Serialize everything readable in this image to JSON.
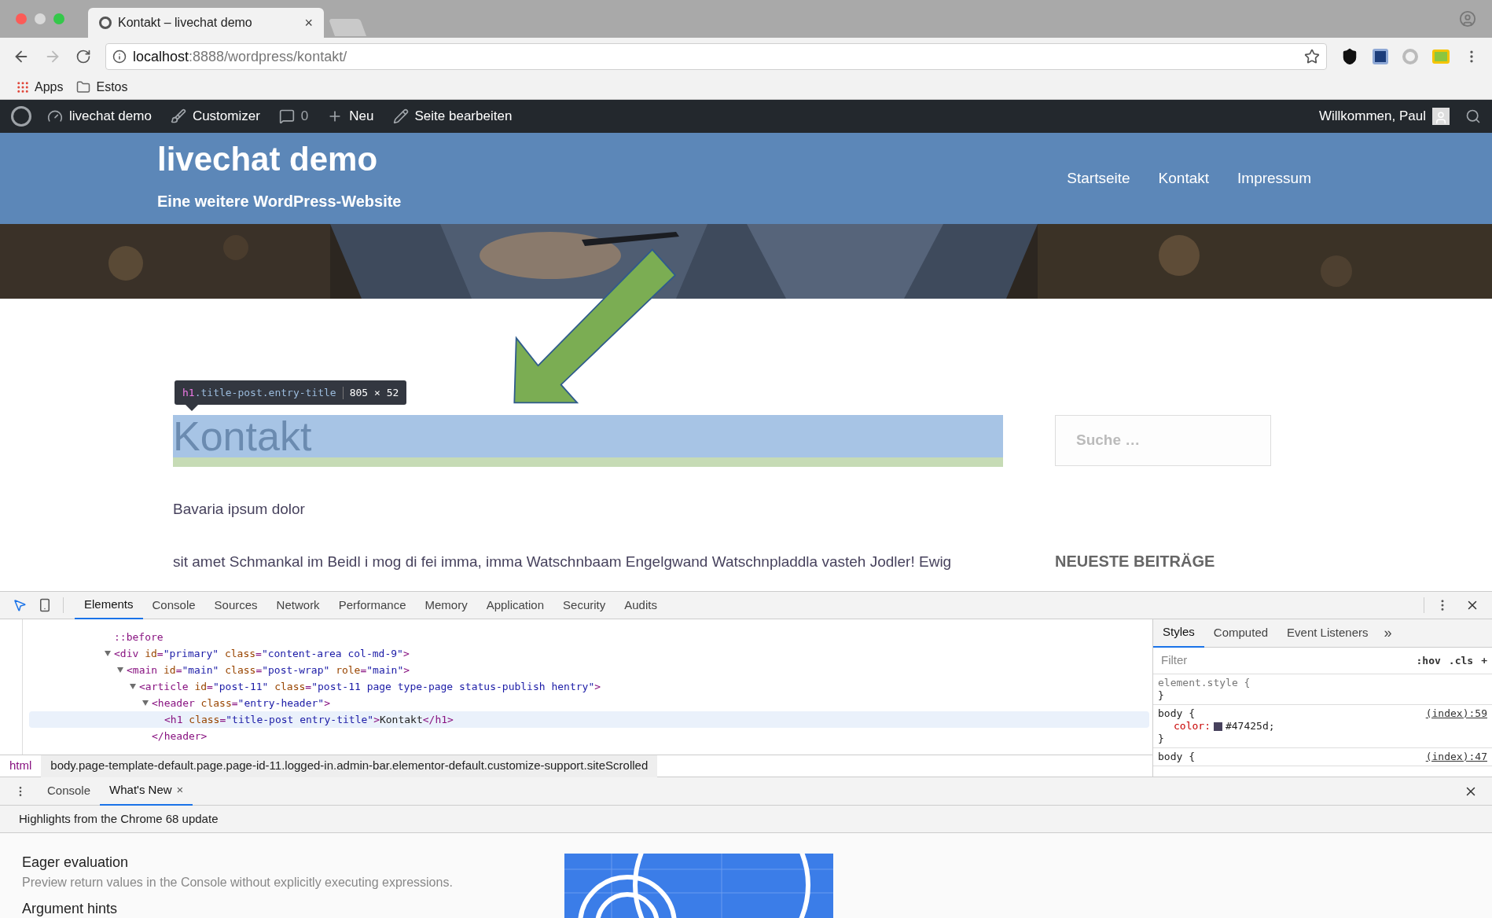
{
  "browser": {
    "tab_title": "Kontakt – livechat demo",
    "tab_close": "×",
    "url_host": "localhost",
    "url_path": ":8888/wordpress/kontakt/",
    "bookmarks": [
      {
        "kind": "apps",
        "label": "Apps"
      },
      {
        "kind": "folder",
        "label": "Estos"
      }
    ]
  },
  "admin_bar": {
    "items": [
      {
        "kind": "site",
        "label": "livechat demo"
      },
      {
        "kind": "customizer",
        "label": "Customizer"
      },
      {
        "kind": "comments",
        "label": "0"
      },
      {
        "kind": "new",
        "label": "Neu"
      },
      {
        "kind": "edit",
        "label": "Seite bearbeiten"
      }
    ],
    "greeting": "Willkommen, Paul"
  },
  "site": {
    "title": "livechat demo",
    "tagline": "Eine weitere WordPress-Website",
    "nav": [
      {
        "label": "Startseite"
      },
      {
        "label": "Kontakt"
      },
      {
        "label": "Impressum"
      }
    ]
  },
  "inspector_tooltip": {
    "tag": "h1",
    "classes": ".title-post.entry-title",
    "size": "805 × 52"
  },
  "page": {
    "heading": "Kontakt",
    "paragraphs": [
      "Bavaria ipsum dolor",
      "sit amet Schmankal im Beidl i mog di fei imma, imma Watschnbaam Engelgwand Watschnpladdla vasteh Jodler! Ewig"
    ],
    "search_placeholder": "Suche …",
    "sidebar_heading": "NEUESTE BEITRÄGE"
  },
  "devtools": {
    "tabs": [
      {
        "label": "Elements",
        "selected": true
      },
      {
        "label": "Console",
        "selected": false
      },
      {
        "label": "Sources",
        "selected": false
      },
      {
        "label": "Network",
        "selected": false
      },
      {
        "label": "Performance",
        "selected": false
      },
      {
        "label": "Memory",
        "selected": false
      },
      {
        "label": "Application",
        "selected": false
      },
      {
        "label": "Security",
        "selected": false
      },
      {
        "label": "Audits",
        "selected": false
      }
    ],
    "dom": [
      {
        "tokens": [
          {
            "kind": "pseudo",
            "s": "::before"
          }
        ],
        "selected": false
      },
      {
        "tokens": [
          {
            "kind": "tag",
            "s": "<div"
          },
          {
            "kind": "attr",
            "s": " id"
          },
          {
            "kind": "tag",
            "s": "="
          },
          {
            "kind": "value",
            "s": "\"primary\""
          },
          {
            "kind": "attr",
            "s": " class"
          },
          {
            "kind": "tag",
            "s": "="
          },
          {
            "kind": "value",
            "s": "\"content-area col-md-9\""
          },
          {
            "kind": "tag",
            "s": ">"
          }
        ],
        "expanded": true,
        "selected": false,
        "children": [
          {
            "tokens": [
              {
                "kind": "tag",
                "s": "<main"
              },
              {
                "kind": "attr",
                "s": " id"
              },
              {
                "kind": "tag",
                "s": "="
              },
              {
                "kind": "value",
                "s": "\"main\""
              },
              {
                "kind": "attr",
                "s": " class"
              },
              {
                "kind": "tag",
                "s": "="
              },
              {
                "kind": "value",
                "s": "\"post-wrap\""
              },
              {
                "kind": "attr",
                "s": " role"
              },
              {
                "kind": "tag",
                "s": "="
              },
              {
                "kind": "value",
                "s": "\"main\""
              },
              {
                "kind": "tag",
                "s": ">"
              }
            ],
            "expanded": true,
            "selected": false,
            "children": [
              {
                "tokens": [
                  {
                    "kind": "tag",
                    "s": "<article"
                  },
                  {
                    "kind": "attr",
                    "s": " id"
                  },
                  {
                    "kind": "tag",
                    "s": "="
                  },
                  {
                    "kind": "value",
                    "s": "\"post-11\""
                  },
                  {
                    "kind": "attr",
                    "s": " class"
                  },
                  {
                    "kind": "tag",
                    "s": "="
                  },
                  {
                    "kind": "value",
                    "s": "\"post-11 page type-page status-publish hentry\""
                  },
                  {
                    "kind": "tag",
                    "s": ">"
                  }
                ],
                "expanded": true,
                "selected": false,
                "children": [
                  {
                    "tokens": [
                      {
                        "kind": "tag",
                        "s": "<header"
                      },
                      {
                        "kind": "attr",
                        "s": " class"
                      },
                      {
                        "kind": "tag",
                        "s": "="
                      },
                      {
                        "kind": "value",
                        "s": "\"entry-header\""
                      },
                      {
                        "kind": "tag",
                        "s": ">"
                      }
                    ],
                    "expanded": true,
                    "selected": false,
                    "close": "</header>",
                    "children": [
                      {
                        "tokens": [
                          {
                            "kind": "tag",
                            "s": "<h1"
                          },
                          {
                            "kind": "attr",
                            "s": " class"
                          },
                          {
                            "kind": "tag",
                            "s": "="
                          },
                          {
                            "kind": "value",
                            "s": "\"title-post entry-title\""
                          },
                          {
                            "kind": "tag",
                            "s": ">"
                          },
                          {
                            "kind": "text",
                            "s": "Kontakt"
                          },
                          {
                            "kind": "tag",
                            "s": "</h1>"
                          }
                        ],
                        "selected": true
                      }
                    ]
                  }
                ]
              }
            ]
          }
        ]
      }
    ],
    "breadcrumbs": [
      {
        "label": "html",
        "selected": false
      },
      {
        "label": "body.page-template-default.page.page-id-11.logged-in.admin-bar.elementor-default.customize-support.siteScrolled",
        "selected": true
      }
    ],
    "side_tabs": [
      {
        "label": "Styles",
        "selected": true
      },
      {
        "label": "Computed",
        "selected": false
      },
      {
        "label": "Event Listeners",
        "selected": false
      }
    ],
    "side_more": "»",
    "filter_placeholder": "Filter",
    "filter_buttons": [
      ":hov",
      ".cls",
      "+"
    ],
    "rules": [
      {
        "open": "element.style {",
        "close": "}"
      },
      {
        "open": "body {",
        "source": "(index):59",
        "close": "}",
        "declarations": [
          {
            "prop": "color",
            "colon": ":",
            "value": "#47425d;",
            "color": "#47425d"
          }
        ]
      },
      {
        "open": "body {",
        "source": "(index):47"
      }
    ]
  },
  "drawer": {
    "tabs": [
      {
        "label": "Console",
        "selected": false
      },
      {
        "label": "What's New",
        "selected": true,
        "close": "×"
      }
    ],
    "banner": "Highlights from the Chrome 68 update",
    "items": [
      {
        "title": "Eager evaluation",
        "description": "Preview return values in the Console without explicitly executing expressions."
      },
      {
        "title": "Argument hints"
      }
    ]
  }
}
